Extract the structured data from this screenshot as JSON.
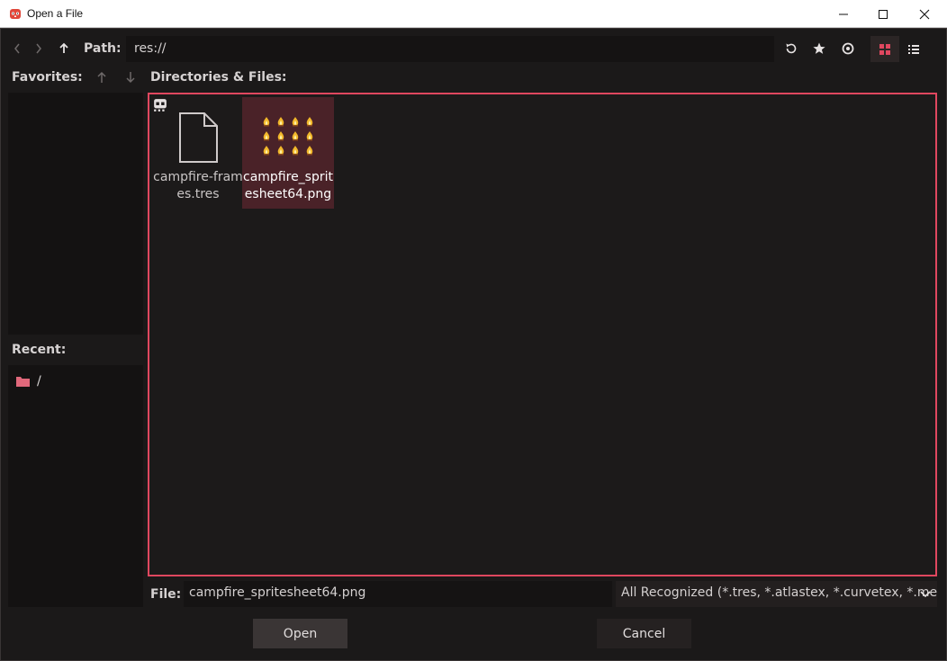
{
  "window": {
    "title": "Open a File"
  },
  "toolbar": {
    "path_label": "Path:",
    "path_value": "res://"
  },
  "favorites": {
    "label": "Favorites:"
  },
  "recent": {
    "label": "Recent:",
    "items": [
      {
        "label": "/"
      }
    ]
  },
  "files": {
    "label": "Directories & Files:",
    "items": [
      {
        "name": "campfire-frames.tres",
        "selected": false
      },
      {
        "name": "campfire_spritesheet64.png",
        "selected": true
      }
    ]
  },
  "footer": {
    "file_label": "File:",
    "file_value": "campfire_spritesheet64.png",
    "filter_value": "All Recognized (*.tres, *.atlastex, *.curvetex, *.me",
    "open_label": "Open",
    "cancel_label": "Cancel"
  },
  "colors": {
    "accent": "#e0475f",
    "selection": "#4a2228",
    "background": "#1b1919"
  },
  "icons": [
    "app-icon",
    "minimize-icon",
    "maximize-icon",
    "close-icon",
    "back-icon",
    "forward-icon",
    "up-icon",
    "refresh-icon",
    "favorite-star-icon",
    "show-hidden-icon",
    "grid-view-icon",
    "list-view-icon",
    "move-up-icon",
    "move-down-icon",
    "folder-icon",
    "file-icon",
    "image-icon",
    "thumbnail-toggle-icon",
    "chevron-down-icon"
  ]
}
